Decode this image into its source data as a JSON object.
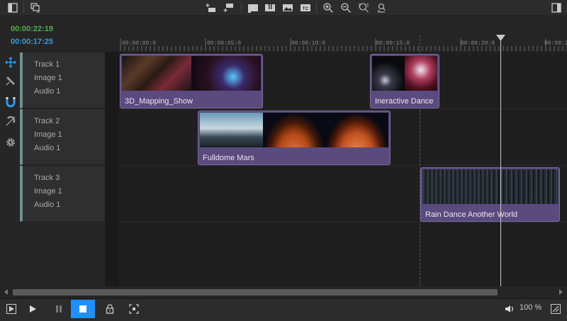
{
  "timecodes": {
    "current": "00:00:22:19",
    "duration": "00:00:17:25"
  },
  "ruler_labels": [
    "00:00:00:0",
    "00:00:05:0",
    "00:00:10:0",
    "00:00:15:0",
    "00:00:20:0",
    "00:00:2"
  ],
  "tracks": [
    {
      "name": "Track 1",
      "image": "Image 1",
      "audio": "Audio 1"
    },
    {
      "name": "Track 2",
      "image": "Image 1",
      "audio": "Audio 1"
    },
    {
      "name": "Track 3",
      "image": "Image 1",
      "audio": "Audio 1"
    }
  ],
  "clips": [
    {
      "name": "3D_Mapping_Show"
    },
    {
      "name": "Ineractive Dance"
    },
    {
      "name": "Fulldome Mars"
    },
    {
      "name": "Rain Dance Another World"
    }
  ],
  "bottom": {
    "volume_percent": "100 %"
  },
  "colors": {
    "clip": "#5a4a7e",
    "accent": "#1e90ff",
    "timecode_current": "#4caf50",
    "timecode_duration": "#3a9ad9",
    "track_stripe": "#6f8f94"
  },
  "icons": {
    "toolbar": [
      "panel-left-icon",
      "layers-icon",
      "add-track-above-icon",
      "add-track-below-icon",
      "marker-icon",
      "split-icon",
      "image-icon",
      "timecode-icon",
      "zoom-in-icon",
      "zoom-out-icon",
      "zoom-fit-icon",
      "zoom-reset-icon",
      "panel-right-icon"
    ],
    "tools": [
      "move-icon",
      "razor-icon",
      "magnet-icon",
      "snap-off-icon",
      "gear-icon"
    ],
    "bottom": [
      "play-preview-icon",
      "play-icon",
      "pause-icon",
      "stop-icon",
      "lock-icon",
      "fullscreen-icon",
      "volume-icon",
      "expand-icon"
    ]
  }
}
